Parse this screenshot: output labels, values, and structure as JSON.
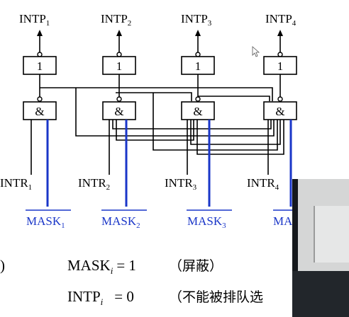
{
  "labels": {
    "intp": [
      {
        "base": "INTP",
        "sub": "1"
      },
      {
        "base": "INTP",
        "sub": "2"
      },
      {
        "base": "INTP",
        "sub": "3"
      },
      {
        "base": "INTP",
        "sub": "4"
      }
    ],
    "intr": [
      {
        "base": "INTR",
        "sub": "1"
      },
      {
        "base": "INTR",
        "sub": "2"
      },
      {
        "base": "INTR",
        "sub": "3"
      },
      {
        "base": "INTR",
        "sub": "4"
      }
    ],
    "mask": [
      {
        "base": "MASK",
        "sub": "1"
      },
      {
        "base": "MASK",
        "sub": "2"
      },
      {
        "base": "MASK",
        "sub": "3"
      },
      {
        "base": "MA",
        "sub": ""
      }
    ],
    "gate_or": "1",
    "gate_and": "&"
  },
  "bottom_text": {
    "left_paren": ")",
    "line1": {
      "base": "MASK",
      "sub": "i",
      "value": "= 1",
      "note": "（屏蔽）"
    },
    "line2": {
      "base": "INTP",
      "sub": "i",
      "value": "= 0",
      "note": "（不能被排队选"
    }
  },
  "colors": {
    "mask_line": "#1a36c8",
    "wire": "#000000"
  },
  "overlay": "webcam-video"
}
